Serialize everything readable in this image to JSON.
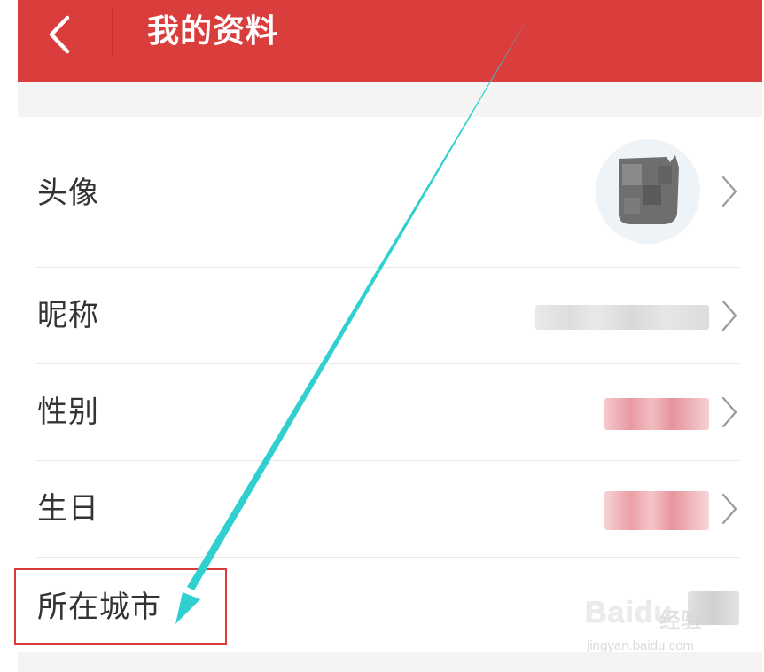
{
  "header": {
    "title": "我的资料",
    "back_icon": "chevron-left-icon",
    "background_color": "#da3e3c"
  },
  "rows": [
    {
      "label": "头像",
      "value_type": "avatar"
    },
    {
      "label": "昵称",
      "value_type": "blurred-text"
    },
    {
      "label": "性别",
      "value_type": "blurred-text"
    },
    {
      "label": "生日",
      "value_type": "blurred-text"
    },
    {
      "label": "所在城市",
      "value_type": "blurred-text"
    }
  ],
  "annotation": {
    "highlight_color": "#d93b3b",
    "arrow_color": "#2fd0cf"
  },
  "watermark": {
    "brand": "Baidu",
    "brand_cn": "经验",
    "url": "jingyan.baidu.com"
  }
}
